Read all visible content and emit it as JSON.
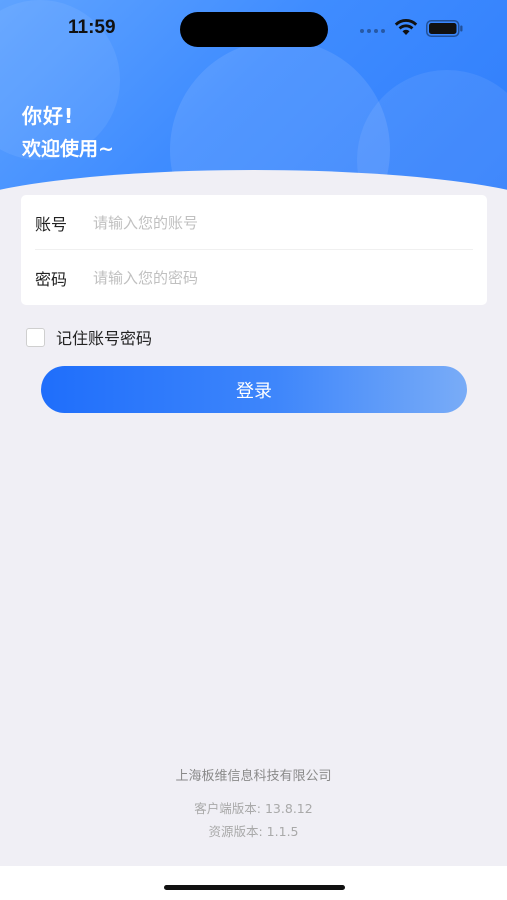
{
  "status_bar": {
    "time": "11:59"
  },
  "greeting": {
    "line1": "你好!",
    "line2": "欢迎使用~"
  },
  "form": {
    "account": {
      "label": "账号",
      "placeholder": "请输入您的账号",
      "value": ""
    },
    "password": {
      "label": "密码",
      "placeholder": "请输入您的密码",
      "value": ""
    },
    "remember_label": "记住账号密码",
    "remember_checked": false,
    "login_label": "登录"
  },
  "footer": {
    "company": "上海板维信息科技有限公司",
    "client_version": "客户端版本: 13.8.12",
    "resource_version": "资源版本: 1.1.5"
  },
  "colors": {
    "brand_blue": "#2f7dfb",
    "background": "#f0eff5"
  },
  "icons": [
    "wifi-icon",
    "battery-icon",
    "signal-icon"
  ]
}
